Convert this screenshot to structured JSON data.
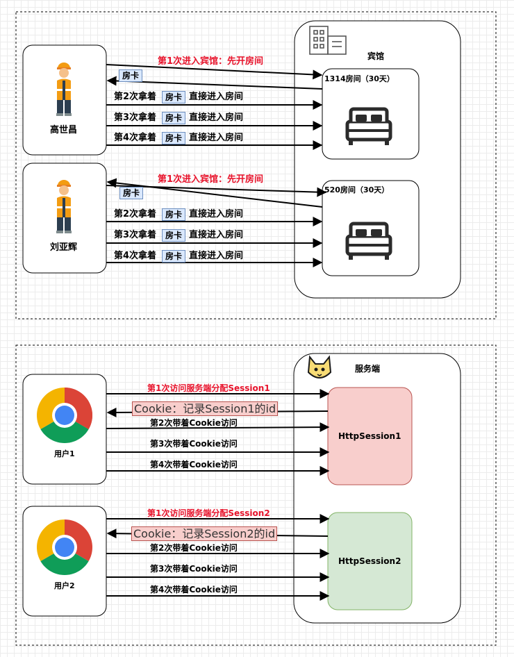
{
  "hotel": {
    "title": "宾馆",
    "guest1": {
      "name": "高世昌"
    },
    "guest2": {
      "name": "刘亚辉"
    },
    "room1": {
      "title": "1314房间（30天）"
    },
    "room2": {
      "title": "520房间（30天）"
    },
    "first_visit": "第1次进入宾馆：先开房间",
    "card_label": "房卡",
    "visits": [
      {
        "prefix": "第2次拿着",
        "suffix": "直接进入房间"
      },
      {
        "prefix": "第3次拿着",
        "suffix": "直接进入房间"
      },
      {
        "prefix": "第4次拿着",
        "suffix": "直接进入房间"
      }
    ]
  },
  "server": {
    "title": "服务端",
    "user1": {
      "name": "用户1"
    },
    "user2": {
      "name": "用户2"
    },
    "session1": {
      "label": "HttpSession1",
      "first_visit": "第1次访问服务端分配Session1",
      "cookie": "Cookie：记录Session1的id"
    },
    "session2": {
      "label": "HttpSession2",
      "first_visit": "第1次访问服务端分配Session2",
      "cookie": "Cookie：记录Session2的id"
    },
    "visits": [
      "第2次带着Cookie访问",
      "第3次带着Cookie访问",
      "第4次带着Cookie访问"
    ]
  },
  "colors": {
    "accent_red": "#e8132b",
    "card_fill": "#dae8fc",
    "session1_fill": "#f8cecc",
    "session2_fill": "#d5e8d4"
  },
  "icons": [
    "building-icon",
    "bed-icon",
    "worker-icon",
    "chrome-icon",
    "tomcat-icon"
  ]
}
